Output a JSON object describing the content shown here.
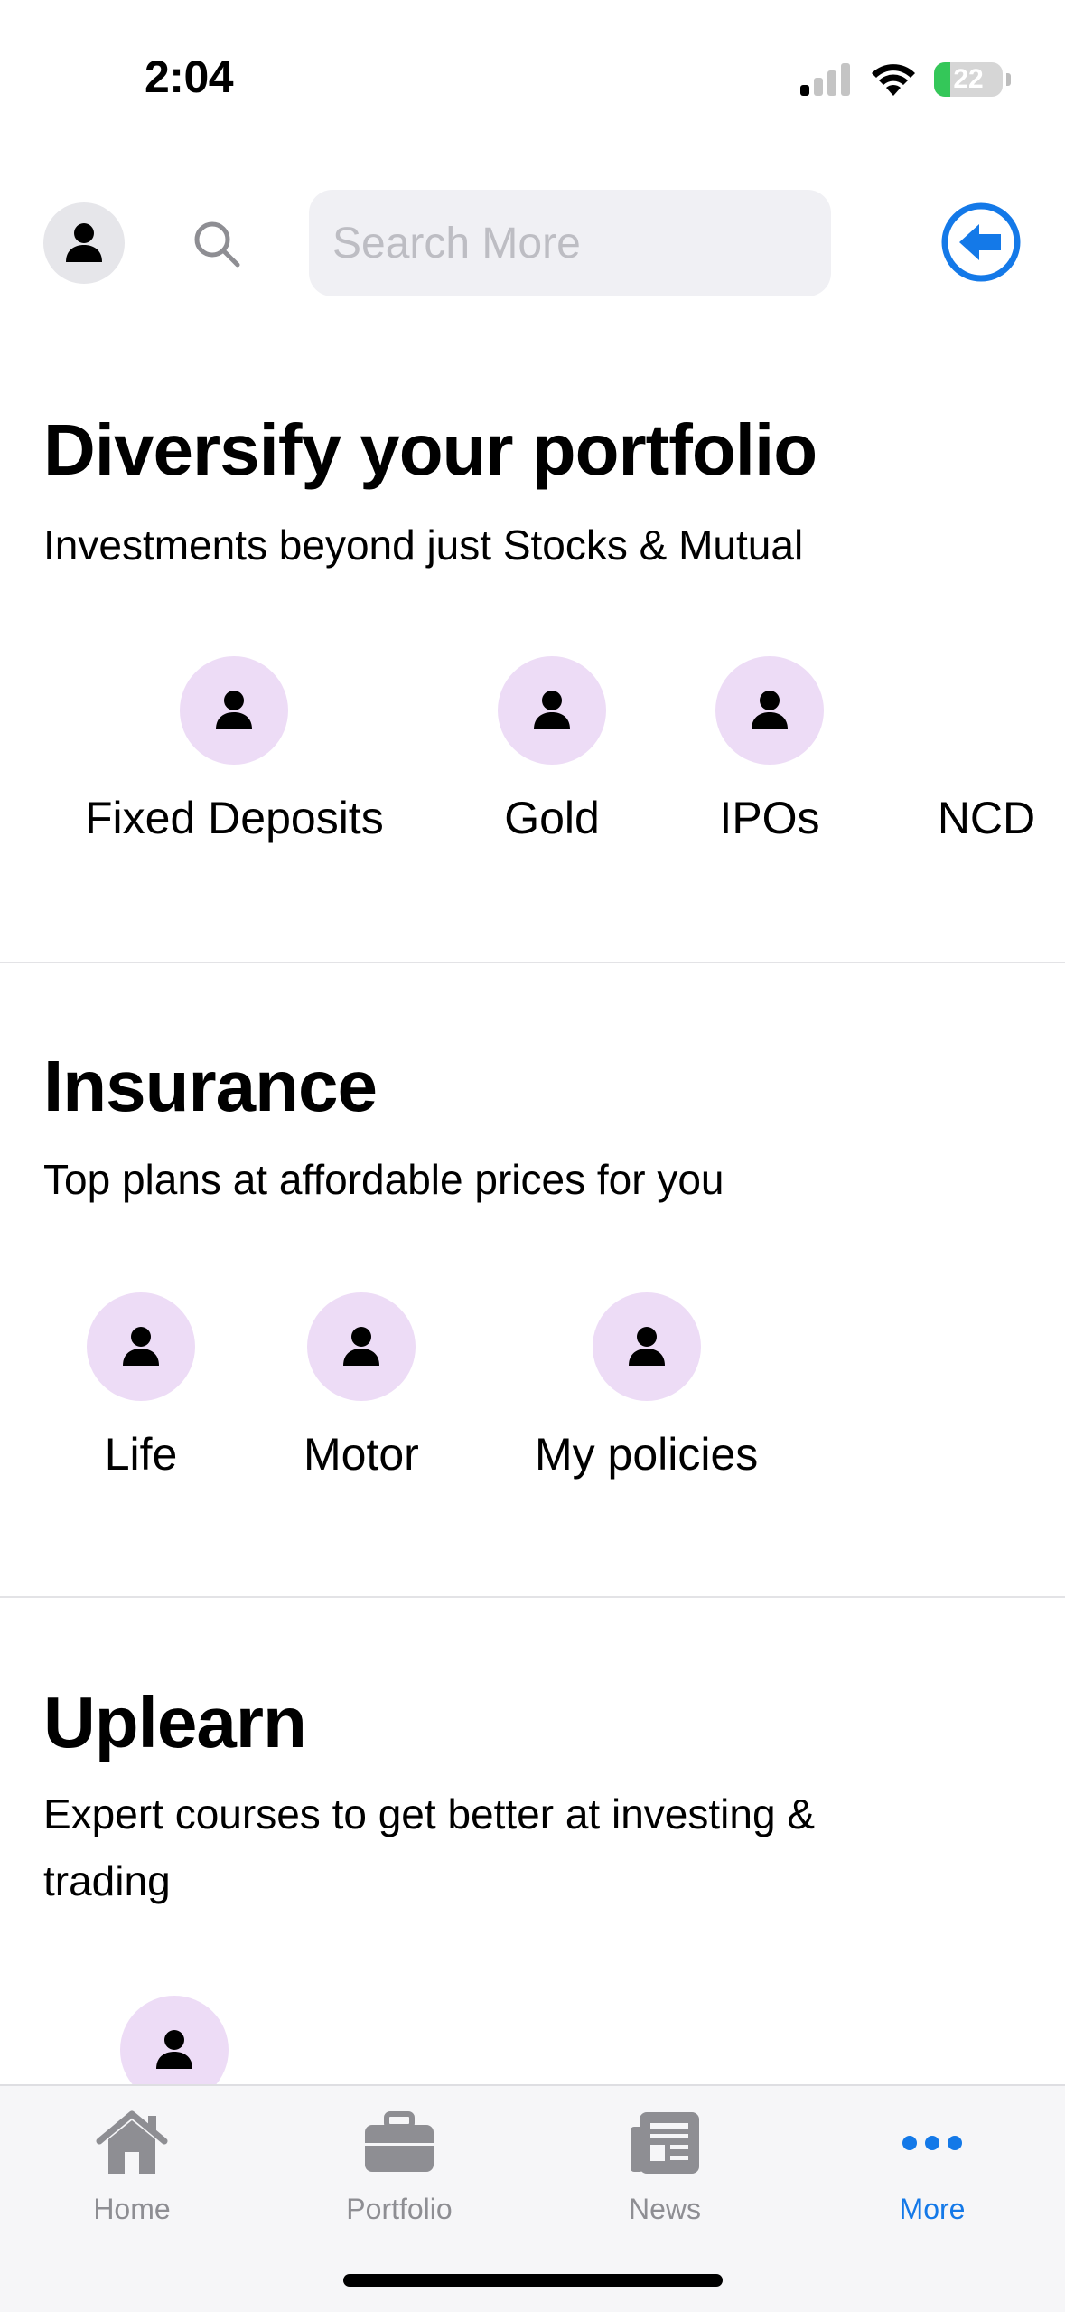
{
  "status_bar": {
    "time": "2:04",
    "battery": "22"
  },
  "header": {
    "search_placeholder": "Search More"
  },
  "sections": [
    {
      "title": "Diversify your portfolio",
      "subtitle": "Investments beyond just Stocks & Mutual",
      "items": [
        {
          "label": "Fixed Deposits"
        },
        {
          "label": "Gold"
        },
        {
          "label": "IPOs"
        },
        {
          "label": "NCD"
        }
      ]
    },
    {
      "title": "Insurance",
      "subtitle": "Top plans at affordable prices for you",
      "items": [
        {
          "label": "Life"
        },
        {
          "label": "Motor"
        },
        {
          "label": "My policies"
        }
      ]
    },
    {
      "title": "Uplearn",
      "subtitle": "Expert courses to get better at investing & trading",
      "items": [
        {
          "label": ""
        }
      ]
    }
  ],
  "tab_bar": {
    "tabs": [
      {
        "label": "Home",
        "icon": "home-icon"
      },
      {
        "label": "Portfolio",
        "icon": "briefcase-icon"
      },
      {
        "label": "News",
        "icon": "newspaper-icon"
      },
      {
        "label": "More",
        "icon": "more-icon"
      }
    ],
    "active": "More"
  },
  "colors": {
    "accent": "#1479e8",
    "tile_bg": "#eddcf6",
    "inactive": "#8e8e93"
  }
}
